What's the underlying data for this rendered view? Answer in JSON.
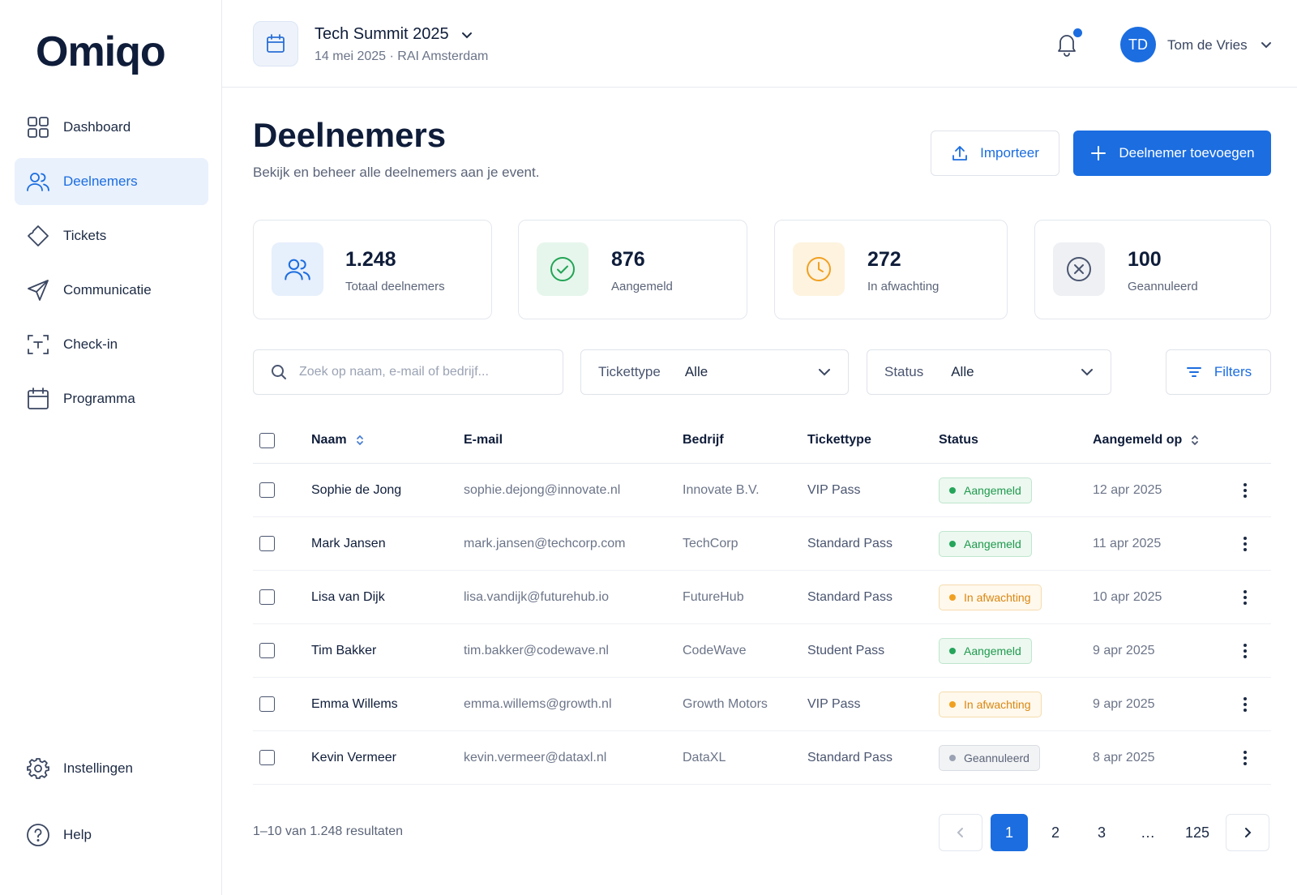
{
  "brand": {
    "name": "Omiqo"
  },
  "sidebar": {
    "items": [
      {
        "label": "Dashboard",
        "icon": "grid-icon"
      },
      {
        "label": "Deelnemers",
        "icon": "users-icon",
        "active": true
      },
      {
        "label": "Tickets",
        "icon": "ticket-icon"
      },
      {
        "label": "Communicatie",
        "icon": "send-icon"
      },
      {
        "label": "Check-in",
        "icon": "scan-icon"
      },
      {
        "label": "Programma",
        "icon": "calendar-icon"
      }
    ],
    "bottom": [
      {
        "label": "Instellingen",
        "icon": "gear-icon"
      },
      {
        "label": "Help",
        "icon": "help-icon"
      }
    ]
  },
  "header": {
    "event_title": "Tech Summit 2025",
    "event_sub": "14 mei 2025 · RAI Amsterdam",
    "notifications_unread": true,
    "user_initials": "TD",
    "user_name": "Tom de Vries"
  },
  "main": {
    "title": "Deelnemers",
    "subtitle": "Bekijk en beheer alle deelnemers aan je event.",
    "import_label": "Importeer",
    "add_label": "Deelnemer toevoegen"
  },
  "stats": [
    {
      "value": "1.248",
      "label": "Totaal deelnemers",
      "icon": "users-icon",
      "color": "#1b6de0",
      "bg": "#e6effc"
    },
    {
      "value": "876",
      "label": "Aangemeld",
      "icon": "check-circle-icon",
      "color": "#22a455",
      "bg": "#e6f6ec"
    },
    {
      "value": "272",
      "label": "In afwachting",
      "icon": "clock-icon",
      "color": "#f0a021",
      "bg": "#fdf3df"
    },
    {
      "value": "100",
      "label": "Geannuleerd",
      "icon": "x-circle-icon",
      "color": "#4a5570",
      "bg": "#eef0f3"
    }
  ],
  "filters": {
    "search_placeholder": "Zoek op naam, e-mail of bedrijf...",
    "search_value": "",
    "ticket_label": "Tickettype",
    "ticket_value": "Alle",
    "status_label": "Status",
    "status_value": "Alle",
    "filters_label": "Filters"
  },
  "table": {
    "columns": [
      "Naam",
      "E-mail",
      "Bedrijf",
      "Tickettype",
      "Status",
      "Aangemeld op"
    ],
    "rows": [
      {
        "name": "Sophie de Jong",
        "email": "sophie.dejong@innovate.nl",
        "company": "Innovate B.V.",
        "ticket": "VIP Pass",
        "status": "Aangemeld",
        "status_type": "ok",
        "date": "12 apr 2025"
      },
      {
        "name": "Mark Jansen",
        "email": "mark.jansen@techcorp.com",
        "company": "TechCorp",
        "ticket": "Standard Pass",
        "status": "Aangemeld",
        "status_type": "ok",
        "date": "11 apr 2025"
      },
      {
        "name": "Lisa van Dijk",
        "email": "lisa.vandijk@futurehub.io",
        "company": "FutureHub",
        "ticket": "Standard Pass",
        "status": "In afwachting",
        "status_type": "wait",
        "date": "10 apr 2025"
      },
      {
        "name": "Tim Bakker",
        "email": "tim.bakker@codewave.nl",
        "company": "CodeWave",
        "ticket": "Student Pass",
        "status": "Aangemeld",
        "status_type": "ok",
        "date": "9 apr 2025"
      },
      {
        "name": "Emma Willems",
        "email": "emma.willems@growth.nl",
        "company": "Growth Motors",
        "ticket": "VIP Pass",
        "status": "In afwachting",
        "status_type": "wait",
        "date": "9 apr 2025"
      },
      {
        "name": "Kevin Vermeer",
        "email": "kevin.vermeer@dataxl.nl",
        "company": "DataXL",
        "ticket": "Standard Pass",
        "status": "Geannuleerd",
        "status_type": "cancel",
        "date": "8 apr 2025"
      }
    ]
  },
  "pagination": {
    "summary": "1–10 van 1.248 resultaten",
    "pages": [
      "1",
      "2",
      "3",
      "…",
      "125"
    ],
    "current": "1"
  }
}
